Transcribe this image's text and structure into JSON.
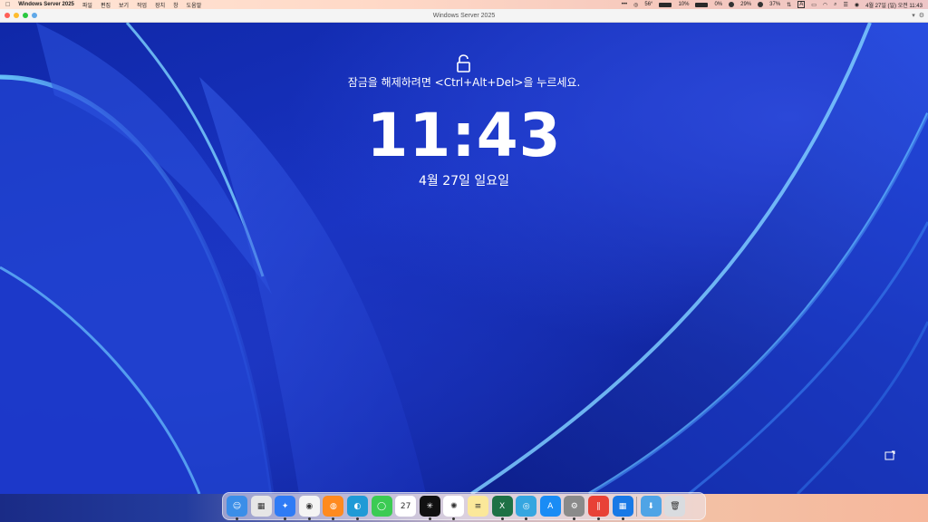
{
  "menubar": {
    "app_name": "Windows Server 2025",
    "items": [
      "파일",
      "편집",
      "보기",
      "작업",
      "장치",
      "창",
      "도움말"
    ],
    "status": {
      "temperature": "56°",
      "battery_1": "10%",
      "battery_2": "0%",
      "cpu": "29%",
      "mem": "37%",
      "input": "A",
      "datetime": "4월 27일 (일) 오전 11:43"
    }
  },
  "window": {
    "title": "Windows Server 2025"
  },
  "lockscreen": {
    "prompt": "잠금을 해제하려면 <Ctrl+Alt+Del>을 누르세요.",
    "time": "11:43",
    "date": "4월 27일 일요일"
  },
  "dock": {
    "apps": [
      {
        "name": "finder",
        "color": "#3b8ee8",
        "glyph": "☺",
        "running": true
      },
      {
        "name": "launchpad",
        "color": "#e6e6e6",
        "glyph": "▦",
        "running": false
      },
      {
        "name": "safari",
        "color": "#2f7bf5",
        "glyph": "✦",
        "running": true
      },
      {
        "name": "chrome",
        "color": "#f4f4f4",
        "glyph": "◉",
        "running": true
      },
      {
        "name": "firefox",
        "color": "#ff8a1f",
        "glyph": "◍",
        "running": true
      },
      {
        "name": "edge",
        "color": "#1f9ad6",
        "glyph": "◐",
        "running": true
      },
      {
        "name": "messages",
        "color": "#3ccb53",
        "glyph": "◯",
        "running": false
      },
      {
        "name": "calendar",
        "color": "#ffffff",
        "glyph": "27",
        "running": false
      },
      {
        "name": "perplexity",
        "color": "#111111",
        "glyph": "✳",
        "running": true
      },
      {
        "name": "chatgpt",
        "color": "#ffffff",
        "glyph": "✺",
        "running": true
      },
      {
        "name": "notes",
        "color": "#fbe89a",
        "glyph": "≡",
        "running": false
      },
      {
        "name": "excel",
        "color": "#1e7145",
        "glyph": "X",
        "running": true
      },
      {
        "name": "qmk",
        "color": "#35a6e0",
        "glyph": "◎",
        "running": true
      },
      {
        "name": "app-store",
        "color": "#1a8cf5",
        "glyph": "A",
        "running": false
      },
      {
        "name": "system-settings",
        "color": "#8a8a8a",
        "glyph": "⚙",
        "running": true
      },
      {
        "name": "parallels",
        "color": "#e84136",
        "glyph": "∥",
        "running": true
      },
      {
        "name": "windows",
        "color": "#1979e6",
        "glyph": "▦",
        "running": true
      },
      {
        "name": "downloads-folder",
        "color": "#4fa4e6",
        "glyph": "⬇",
        "running": false
      },
      {
        "name": "trash",
        "color": "#d9dce0",
        "glyph": "🗑",
        "running": false
      }
    ]
  }
}
